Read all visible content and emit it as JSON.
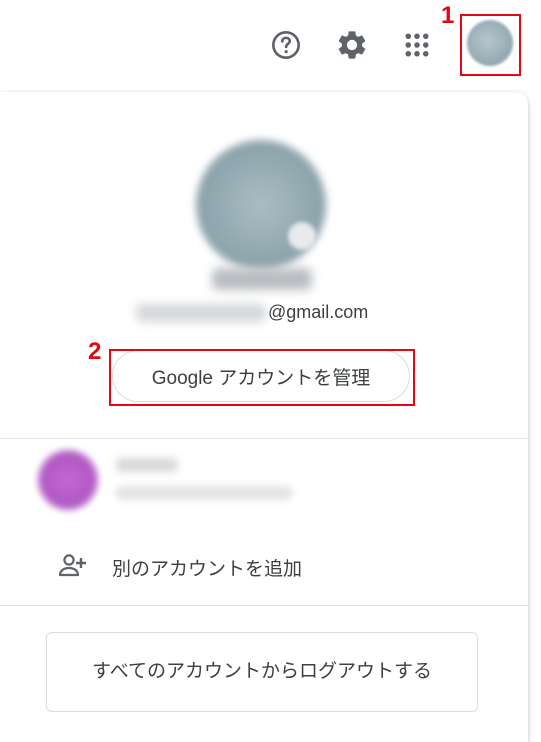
{
  "header": {
    "icons": [
      "help-icon",
      "settings-icon",
      "apps-grid-icon",
      "account-avatar"
    ]
  },
  "annotations": {
    "num1": "1",
    "num2": "2",
    "highlight_color": "#e30613"
  },
  "profile": {
    "email_suffix": "@gmail.com"
  },
  "manage_account_button": {
    "label": "Google アカウントを管理"
  },
  "add_account": {
    "label": "別のアカウントを追加"
  },
  "logout_button": {
    "label": "すべてのアカウントからログアウトする"
  },
  "colors": {
    "icon": "#5f6368",
    "text": "#3c4043",
    "border": "#dadce0",
    "other_account_avatar": "#c567d6"
  }
}
